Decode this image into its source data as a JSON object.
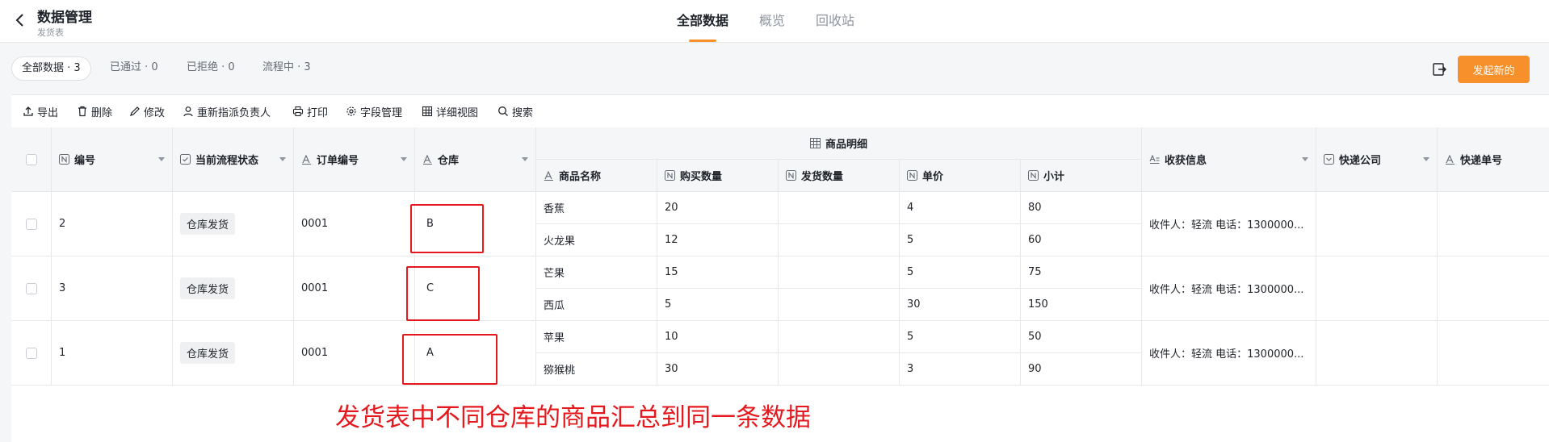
{
  "header": {
    "title": "数据管理",
    "subtitle": "发货表",
    "tabs": [
      {
        "label": "全部数据"
      },
      {
        "label": "概览"
      },
      {
        "label": "回收站"
      }
    ]
  },
  "filters": [
    {
      "label": "全部数据 · 3"
    },
    {
      "label": "已通过 · 0"
    },
    {
      "label": "已拒绝 · 0"
    },
    {
      "label": "流程中 · 3"
    }
  ],
  "primary_button": "发起新的",
  "toolbar": {
    "export": "导出",
    "delete": "删除",
    "edit": "修改",
    "reassign": "重新指派负责人",
    "print": "打印",
    "fields": "字段管理",
    "detail_view": "详细视图",
    "search": "搜索"
  },
  "columns": {
    "id": "编号",
    "status": "当前流程状态",
    "order_no": "订单编号",
    "warehouse": "仓库",
    "group": "商品明细",
    "product": "商品名称",
    "qty": "购买数量",
    "ship_qty": "发货数量",
    "price": "单价",
    "subtotal": "小计",
    "receiver": "收获信息",
    "courier": "快递公司",
    "tracking": "快递单号"
  },
  "rows": [
    {
      "id": "2",
      "status": "仓库发货",
      "order_no": "0001",
      "warehouse": "B",
      "items": [
        {
          "name": "香蕉",
          "qty": "20",
          "ship_qty": "",
          "price": "4",
          "subtotal": "80"
        },
        {
          "name": "火龙果",
          "qty": "12",
          "ship_qty": "",
          "price": "5",
          "subtotal": "60"
        }
      ],
      "receiver": "收件人：轻流 电话：1300000..."
    },
    {
      "id": "3",
      "status": "仓库发货",
      "order_no": "0001",
      "warehouse": "C",
      "items": [
        {
          "name": "芒果",
          "qty": "15",
          "ship_qty": "",
          "price": "5",
          "subtotal": "75"
        },
        {
          "name": "西瓜",
          "qty": "5",
          "ship_qty": "",
          "price": "30",
          "subtotal": "150"
        }
      ],
      "receiver": "收件人：轻流 电话：1300000..."
    },
    {
      "id": "1",
      "status": "仓库发货",
      "order_no": "0001",
      "warehouse": "A",
      "items": [
        {
          "name": "苹果",
          "qty": "10",
          "ship_qty": "",
          "price": "5",
          "subtotal": "50"
        },
        {
          "name": "猕猴桃",
          "qty": "30",
          "ship_qty": "",
          "price": "3",
          "subtotal": "90"
        }
      ],
      "receiver": "收件人：轻流 电话：1300000..."
    }
  ],
  "annotation": "发货表中不同仓库的商品汇总到同一条数据",
  "colors": {
    "accent": "#f7902b",
    "annotation": "#e5191d"
  }
}
